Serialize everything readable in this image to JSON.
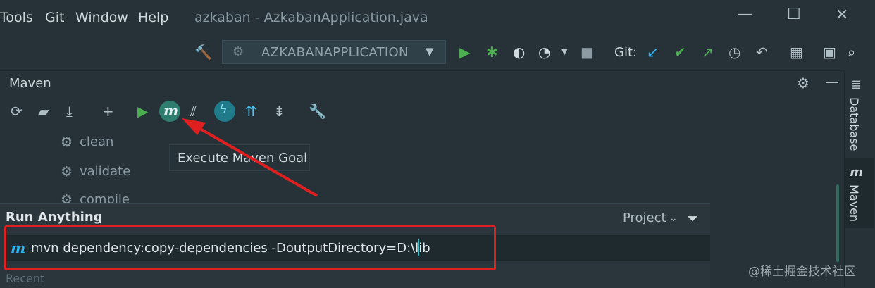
{
  "menu": {
    "items": [
      "Tools",
      "Git",
      "Window",
      "Help"
    ]
  },
  "window": {
    "title": "azkaban - AzkabanApplication.java"
  },
  "toolbar": {
    "run_config": "AZKABANAPPLICATION",
    "git_label": "Git:"
  },
  "maven_panel": {
    "title": "Maven",
    "goals": [
      "clean",
      "validate",
      "compile"
    ]
  },
  "tooltip": {
    "text": "Execute Maven Goal"
  },
  "right_strip": {
    "database": "Database",
    "maven": "Maven",
    "maven_icon": "m"
  },
  "run_anything": {
    "title": "Run Anything",
    "scope": "Project",
    "command": "mvn dependency:copy-dependencies -DoutputDirectory=D:\\lib",
    "recent": "Recent"
  },
  "watermark": "@稀土掘金技术社区",
  "icons": {
    "maven_logo": "m",
    "colors": {
      "green": "#4caf50",
      "teal": "#26a69a",
      "highlight": "#e02020",
      "blue": "#29b6f6"
    }
  }
}
